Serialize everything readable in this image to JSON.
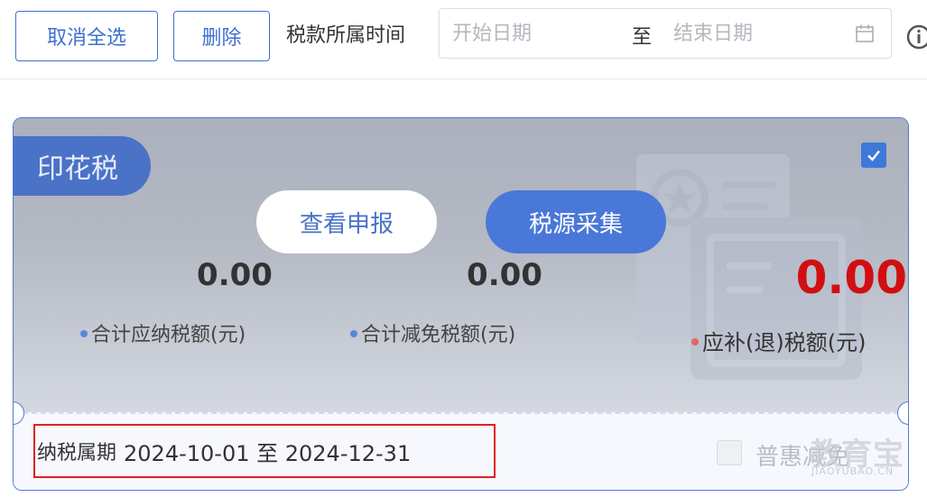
{
  "toolbar": {
    "cancel_select_all": "取消全选",
    "delete": "删除",
    "tax_period_label": "税款所属时间",
    "start_placeholder": "开始日期",
    "range_separator": "至",
    "end_placeholder": "结束日期"
  },
  "card": {
    "tax_name": "印花税",
    "checked": true,
    "view_declaration": "查看申报",
    "source_collection": "税源采集",
    "total_payable_amount": "0.00",
    "total_payable_label": "合计应纳税额(元)",
    "total_relief_amount": "0.00",
    "total_relief_label": "合计减免税额(元)",
    "refund_amount": "0.00",
    "refund_label": "应补(退)税额(元)",
    "period_label": "纳税属期",
    "period_value": "2024-10-01 至 2024-12-31",
    "inclusive_label": "普惠减免"
  },
  "watermark": {
    "cn": "教育宝",
    "en": "JIAOYUBAO.CN"
  },
  "colors": {
    "accent": "#3f6fd1",
    "refund_red": "#d10f12",
    "highlight_box": "#e02020"
  },
  "icons": {
    "calendar": "calendar-icon",
    "info": "info-icon",
    "check": "check-icon"
  }
}
